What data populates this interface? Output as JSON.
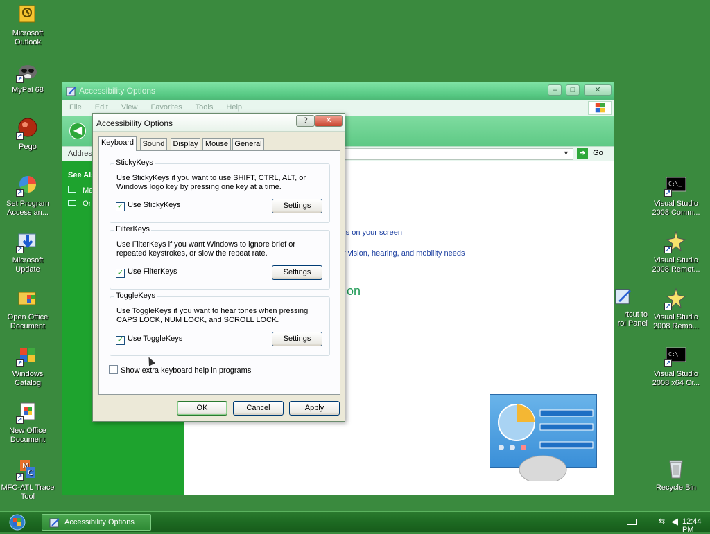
{
  "desktop": {
    "left_icons": [
      {
        "name": "microsoft-outlook",
        "label": "Microsoft Outlook"
      },
      {
        "name": "mypal-68",
        "label": "MyPal 68"
      },
      {
        "name": "pego",
        "label": "Pego"
      },
      {
        "name": "set-program-access",
        "label": "Set Program Access an..."
      },
      {
        "name": "microsoft-update",
        "label": "Microsoft Update"
      },
      {
        "name": "open-office-document",
        "label": "Open Office Document"
      },
      {
        "name": "windows-catalog",
        "label": "Windows Catalog"
      },
      {
        "name": "new-office-document",
        "label": "New Office Document"
      },
      {
        "name": "mfc-atl-trace-tool",
        "label": "MFC-ATL Trace Tool"
      }
    ],
    "right_icons": [
      {
        "name": "vs2008-command",
        "label": "Visual Studio 2008 Comm..."
      },
      {
        "name": "vs2008-remote-1",
        "label": "Visual Studio 2008 Remot..."
      },
      {
        "name": "vs2008-remote-2",
        "label": "Visual Studio 2008 Remo..."
      },
      {
        "name": "vs2008-x64",
        "label": "Visual Studio 2008 x64 Cr..."
      },
      {
        "name": "recycle-bin",
        "label": "Recycle Bin"
      }
    ],
    "partial_shortcut_label": "rtcut to\nrol Panel"
  },
  "control_panel": {
    "title": "Accessibility Options",
    "menu": [
      "File",
      "Edit",
      "View",
      "Favorites",
      "Tools",
      "Help"
    ],
    "address_label": "Addres",
    "go_label": "Go",
    "see_also": "See Als",
    "side_links": [
      "Ma",
      "Or"
    ],
    "link1": "rs on your screen",
    "link2": "r vision, hearing, and mobility needs",
    "heading_fragment": "on"
  },
  "dialog": {
    "title": "Accessibility Options",
    "help_glyph": "?",
    "close_glyph": "✕",
    "tabs": [
      "Keyboard",
      "Sound",
      "Display",
      "Mouse",
      "General"
    ],
    "active_tab": "Keyboard",
    "groups": [
      {
        "legend": "StickyKeys",
        "description": "Use StickyKeys if you want to use SHIFT, CTRL, ALT, or Windows logo key by pressing one key at a time.",
        "checkbox_label": "Use StickyKeys",
        "checked": true,
        "button": "Settings"
      },
      {
        "legend": "FilterKeys",
        "description": "Use FilterKeys if you want Windows to ignore brief or repeated keystrokes, or slow the repeat rate.",
        "checkbox_label": "Use FilterKeys",
        "checked": true,
        "button": "Settings"
      },
      {
        "legend": "ToggleKeys",
        "description": "Use ToggleKeys if you want to hear tones when pressing CAPS LOCK, NUM LOCK, and SCROLL LOCK.",
        "checkbox_label": "Use ToggleKeys",
        "checked": true,
        "button": "Settings"
      }
    ],
    "extra_help_label": "Show extra keyboard help in programs",
    "extra_help_checked": false,
    "buttons": {
      "ok": "OK",
      "cancel": "Cancel",
      "apply": "Apply"
    },
    "check_glyph": "✓"
  },
  "taskbar": {
    "task_label": "Accessibility Options",
    "clock": "12:44 PM"
  }
}
